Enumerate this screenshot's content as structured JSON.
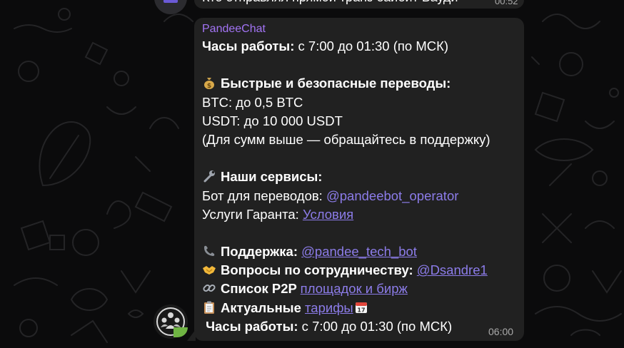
{
  "prev_message": {
    "text": "Кто отправлял прямой транз байбит Бауди",
    "time": "00:52"
  },
  "message": {
    "sender": "PandeeChat",
    "hours_label": "Часы работы:",
    "hours_value": " с 7:00 до 01:30 (по МСК)",
    "transfers_heading": "Быстрые и безопасные переводы:",
    "btc_line": "BTC: до 0,5 BTC",
    "usdt_line": "USDT: до 10 000 USDT",
    "support_note": "(Для сумм выше — обращайтесь в поддержку)",
    "services_heading": "Наши сервисы:",
    "bot_label": "Бот для переводов: ",
    "bot_link": "@pandeebot_operator",
    "guarantor_label": "Услуги Гаранта: ",
    "guarantor_link": "Условия",
    "support_label": "Поддержка: ",
    "support_link": "@pandee_tech_bot",
    "coop_label": "Вопросы по сотрудничеству: ",
    "coop_link": "@Dsandre1",
    "p2p_label": "Список P2P ",
    "p2p_link": "площадок и бирж",
    "tariffs_label": "Актуальные ",
    "tariffs_link": "тарифы",
    "hours_label_2": "Часы работы:",
    "hours_value_2": " с 7:00 до 01:30 (по МСК)",
    "time": "06:00"
  },
  "icons": [
    "money-bag-icon",
    "wrench-icon",
    "telephone-icon",
    "handshake-icon",
    "link-icon",
    "clipboard-icon",
    "calendar-icon"
  ],
  "colors": {
    "background": "#0b0b0c",
    "bubble": "#212121",
    "sender": "#a374f5",
    "link": "#8c7ce9",
    "time": "#aaaaaa"
  }
}
